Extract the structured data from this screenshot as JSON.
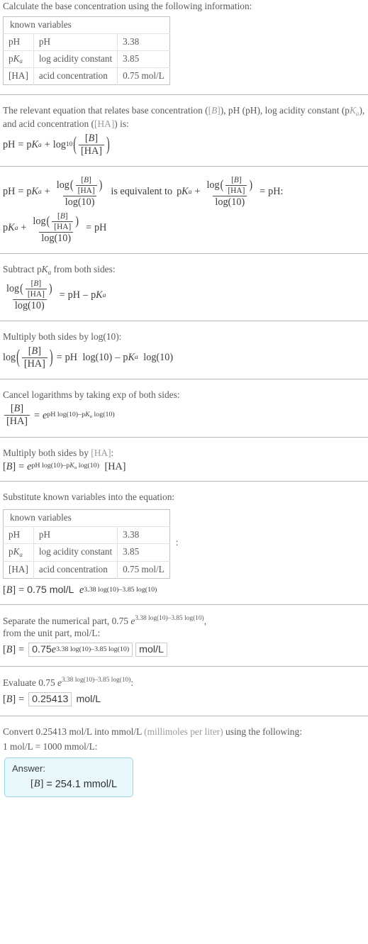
{
  "intro": {
    "prompt": "Calculate the base concentration using the following information:"
  },
  "known_table": {
    "header": "known variables",
    "rows": [
      {
        "symbol": "pH",
        "symbol_sub": "",
        "description": "pH",
        "value": "3.38"
      },
      {
        "symbol": "p",
        "symbol_italic": "K",
        "symbol_sub": "a",
        "description": "log acidity constant",
        "value": "3.85"
      },
      {
        "symbol": "[HA]",
        "symbol_sub": "",
        "description": "acid concentration",
        "value": "0.75 mol/L"
      }
    ]
  },
  "steps": [
    {
      "id": "relevant-equation",
      "text_a": "The relevant equation that relates base concentration (",
      "text_b": "), pH (pH), log acidity constant (p",
      "text_c": "), and acid concentration (",
      "text_d": ") is:"
    },
    {
      "id": "equivalent",
      "connector": "is equivalent to"
    },
    {
      "id": "subtract",
      "text": "Subtract pK_a from both sides:",
      "label_pre": "Subtract p",
      "label_post": " from both sides:"
    },
    {
      "id": "multiply-log10",
      "label": "Multiply both sides by log(10):"
    },
    {
      "id": "cancel-logs",
      "label": "Cancel logarithms by taking exp of both sides:"
    },
    {
      "id": "multiply-ha",
      "label_pre": "Multiply both sides by ",
      "label_post": ":"
    },
    {
      "id": "substitute",
      "label": "Substitute known variables into the equation:"
    },
    {
      "id": "separate",
      "label_pre": "Separate the numerical part, ",
      "label_mid": ", ",
      "label_post": "from the unit part, mol/L:"
    },
    {
      "id": "evaluate",
      "label_pre": "Evaluate ",
      "label_post": ":"
    },
    {
      "id": "convert",
      "label_pre": "Convert ",
      "label_mid": " into mmol/L ",
      "label_paren": "(millimoles per liter)",
      "label_post": " using the following:",
      "conversion": "1 mol/L = 1000 mmol/L:"
    }
  ],
  "symbols": {
    "B": "B",
    "HA": "HA",
    "bracket_B": "[B]",
    "bracket_HA": "[HA]",
    "pH": "pH",
    "pK": "K",
    "p": "p",
    "a": "a",
    "log": "log",
    "log10_base": "10",
    "log_of_10": "log(10)",
    "e": "e",
    "eq": "=",
    "plus": "+",
    "minus": "–",
    "colon": ":",
    "lparen": "(",
    "rparen": ")",
    "lbracket": "[",
    "rbracket": "]"
  },
  "values": {
    "pH": "3.38",
    "pKa": "3.85",
    "HA_conc": "0.75 mol/L",
    "HA_num": "0.75",
    "unit_molL": "mol/L",
    "unit_mmolL": "mmol/L",
    "exponent": "3.38 log(10)–3.85 log(10)",
    "exponent_pH": "pH log(10)–p",
    "exponent_tail": " log(10)",
    "numeric_expr_prefix": "0.75 ",
    "evaluated": "0.25413",
    "evaluated_unit": "0.25413 mol/L",
    "answer_value": "254.1",
    "answer_unit": "mmol/L",
    "one_mol": "1 mol/L",
    "thousand_mmol": "1000 mmol/L"
  },
  "answer_pod": {
    "label": "Answer:",
    "result_lhs": "[B]",
    "result_eq": "=",
    "result_value": "254.1 mmol/L"
  },
  "colors": {
    "text": "#58595b",
    "math": "#3b3b3d",
    "dim": "#9a9a9c",
    "divider": "#b9b9b9",
    "table_border": "#c3c3c3",
    "table_grid": "#e2e2e2",
    "answer_bg": "#e8f7fc",
    "answer_border": "#9fd4e4",
    "box_border": "#c9c9c9"
  }
}
